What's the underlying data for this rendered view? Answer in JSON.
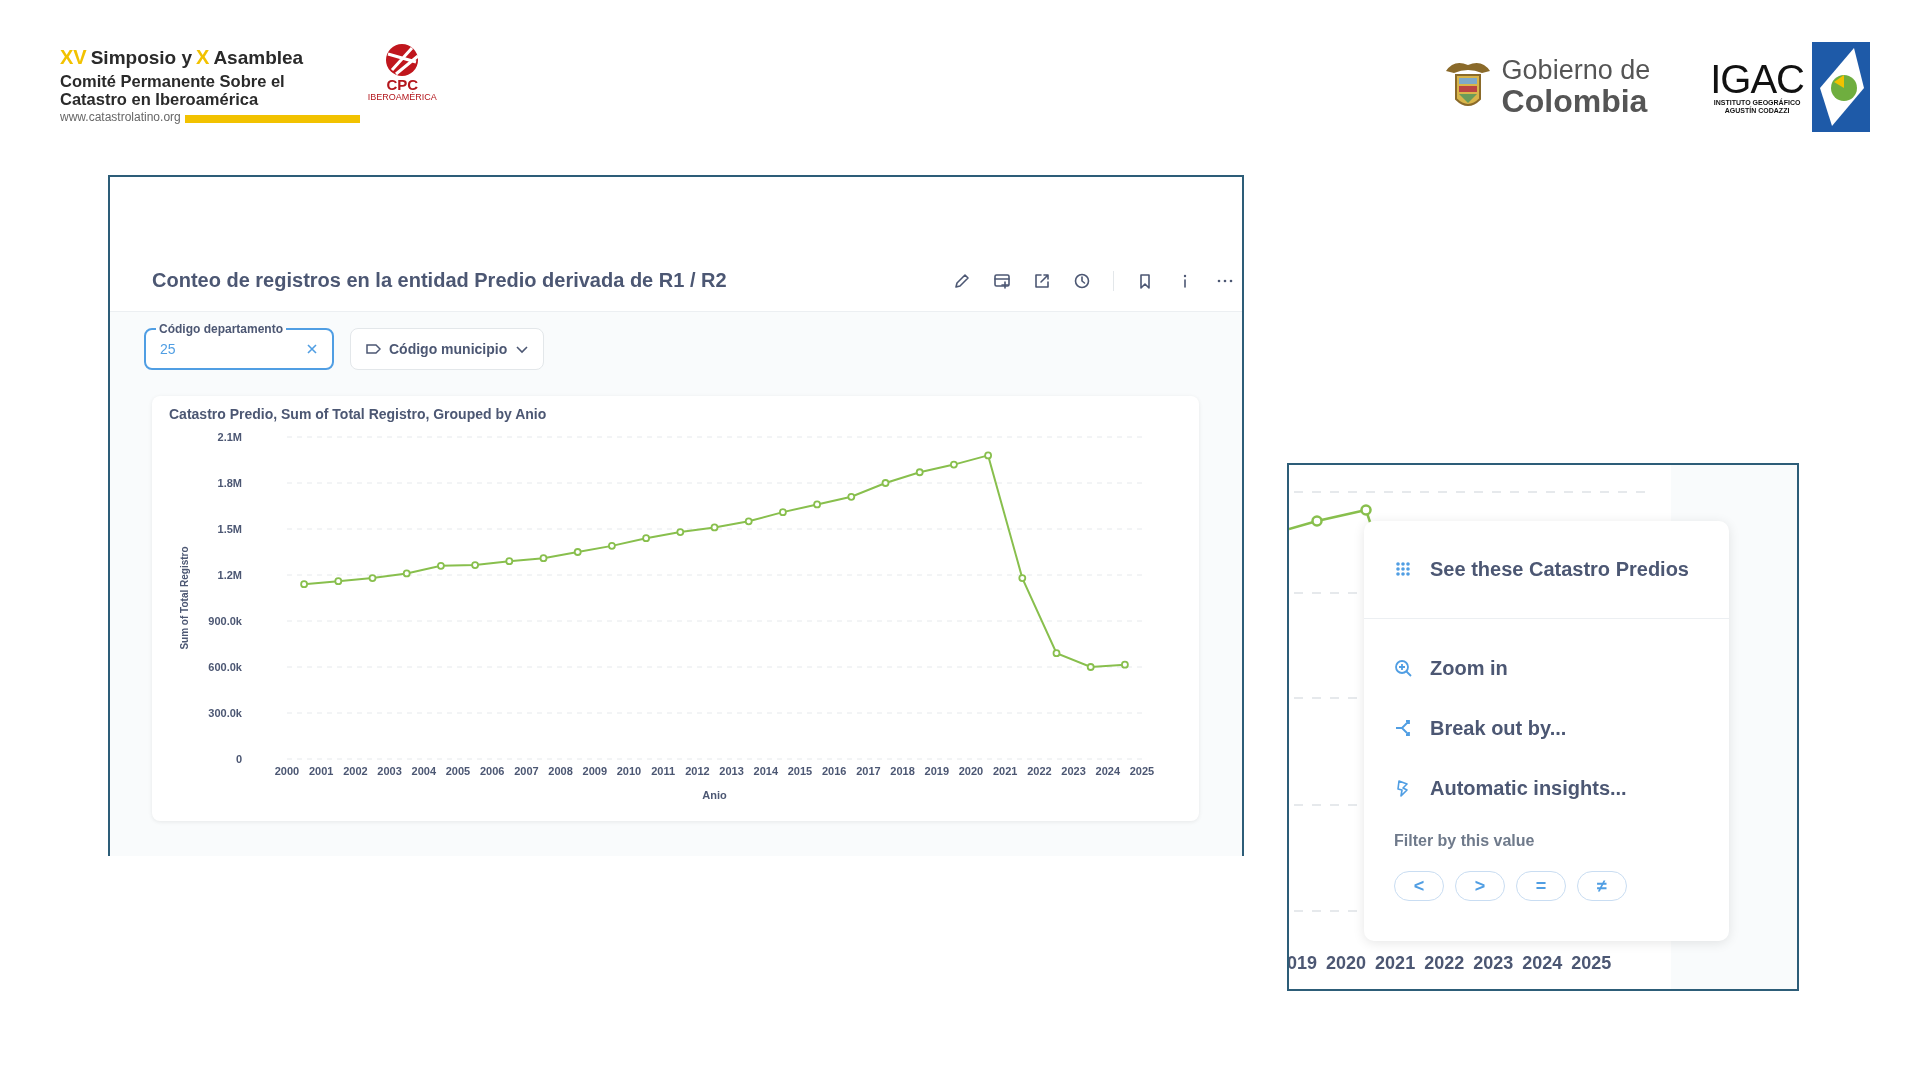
{
  "header": {
    "event_logo": {
      "edition": "XV",
      "line_1a": "Simposio y",
      "assembly": "X",
      "line_1b": "Asamblea",
      "line_2": "Comité Permanente Sobre el",
      "line_3": "Catastro en Iberoamérica",
      "website": "www.catastrolatino.org",
      "badge": "CPC",
      "badge_sub": "IBEROAMÉRICA"
    },
    "government_logo": {
      "line_1": "Gobierno de",
      "line_2": "Colombia"
    },
    "igac_logo": {
      "acronym": "IGAC",
      "line_1": "INSTITUTO GEOGRÁFICO",
      "line_2": "AGUSTÍN CODAZZI"
    }
  },
  "dashboard_card": {
    "title": "Conteo de registros en la entidad Predio derivada de R1 / R2",
    "filters": [
      {
        "kind": "field",
        "label": "Código departamento",
        "value": "25"
      },
      {
        "kind": "dropdown",
        "label": "Código municipio"
      }
    ],
    "chart": {
      "title": "Catastro Predio, Sum of Total Registro, Grouped by Anio",
      "chart_data": {
        "type": "line",
        "xlabel": "Anio",
        "ylabel": "Sum of Total Registro",
        "x": [
          2000.5,
          2001.5,
          2002.5,
          2003.5,
          2004.5,
          2005.5,
          2006.5,
          2007.5,
          2008.5,
          2009.5,
          2010.5,
          2011.5,
          2012.5,
          2013.5,
          2014.5,
          2015.5,
          2016.5,
          2017.5,
          2018.5,
          2019.5,
          2020.5,
          2021.5,
          2022.5,
          2023.5,
          2024.5
        ],
        "grid": true,
        "series": [
          {
            "color": "#88bf4d",
            "marker": true,
            "values": [
              1140000,
              1160000,
              1180000,
              1210000,
              1260000,
              1265000,
              1290000,
              1310000,
              1350000,
              1390000,
              1440000,
              1480000,
              1510000,
              1550000,
              1610000,
              1660000,
              1710000,
              1800000,
              1870000,
              1920000,
              1980000,
              1180000,
              690000,
              600000,
              615000
            ]
          }
        ],
        "xlim": [
          2000,
          2025
        ],
        "ylim": [
          0,
          2100000
        ],
        "xticks": [
          2000,
          2001,
          2002,
          2003,
          2004,
          2005,
          2006,
          2007,
          2008,
          2009,
          2010,
          2011,
          2012,
          2013,
          2014,
          2015,
          2016,
          2017,
          2018,
          2019,
          2020,
          2021,
          2022,
          2023,
          2024,
          2025
        ],
        "yticks": [
          {
            "value": 0,
            "label": "0"
          },
          {
            "value": 300000,
            "label": "300.0k"
          },
          {
            "value": 600000,
            "label": "600.0k"
          },
          {
            "value": 900000,
            "label": "900.0k"
          },
          {
            "value": 1200000,
            "label": "1.2M"
          },
          {
            "value": 1500000,
            "label": "1.5M"
          },
          {
            "value": 1800000,
            "label": "1.8M"
          },
          {
            "value": 2100000,
            "label": "2.1M"
          }
        ]
      }
    }
  },
  "zoom_inset": {
    "x_labels": [
      "019",
      "2020",
      "2021",
      "2022",
      "2023",
      "2024",
      "2025"
    ],
    "menu": {
      "items": [
        {
          "kind": "view",
          "label": "See these Catastro Predios"
        },
        {
          "kind": "zoom",
          "label": "Zoom in"
        },
        {
          "kind": "breakout",
          "label": "Break out by..."
        },
        {
          "kind": "insights",
          "label": "Automatic insights..."
        }
      ],
      "filter_heading": "Filter by this value",
      "filter_buttons": [
        "<",
        ">",
        "=",
        "≠"
      ]
    }
  }
}
